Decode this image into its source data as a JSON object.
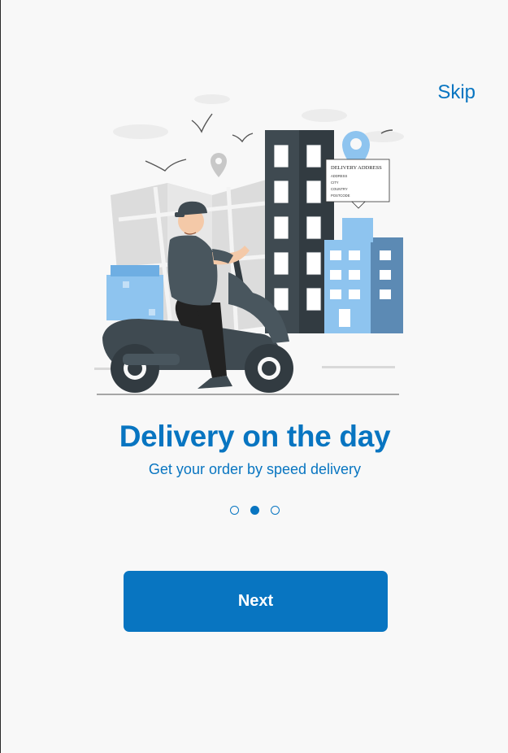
{
  "onboarding": {
    "skip_label": "Skip",
    "title": "Delivery on the day",
    "subtitle": "Get your order by speed delivery",
    "next_label": "Next",
    "pagination": {
      "total": 3,
      "active_index": 1
    }
  },
  "illustration": {
    "card_heading": "DELIVERY ADDRESS",
    "card_lines": [
      "ADDRESS",
      "CITY",
      "COUNTRY",
      "POSTCODE"
    ]
  },
  "colors": {
    "accent": "#0875c1",
    "background": "#f8f8f8",
    "button_text": "#ffffff"
  }
}
